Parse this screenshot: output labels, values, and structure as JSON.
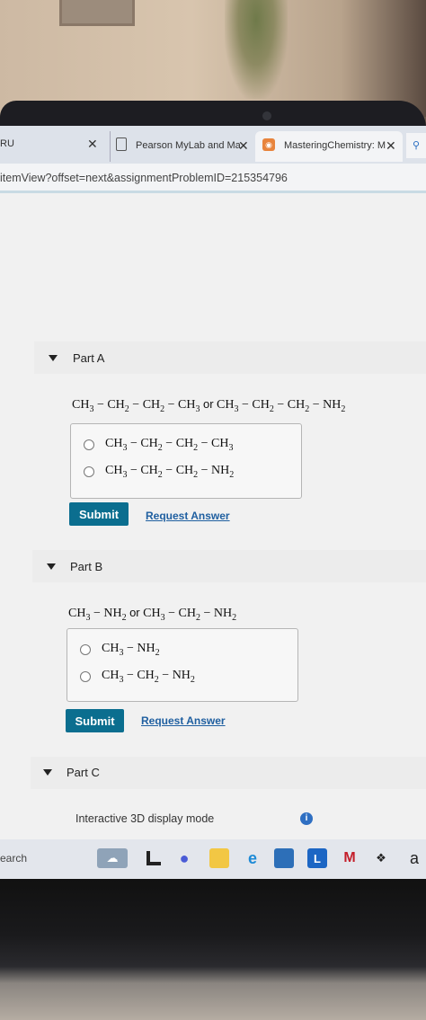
{
  "browser": {
    "tabs": [
      {
        "label": "RU",
        "close": "✕"
      },
      {
        "label": "Pearson MyLab and Ma",
        "close": "✕"
      },
      {
        "label": "MasteringChemistry: M",
        "close": "✕"
      }
    ],
    "url": "itemView?offset=next&assignmentProblemID=215354796"
  },
  "parts": [
    {
      "title": "Part A",
      "question": {
        "left": "CH3 − CH2 − CH2 − CH3",
        "or": "or",
        "right": "CH3 − CH2 − CH2 − NH2"
      },
      "choices": [
        "CH3 − CH2 − CH2 − CH3",
        "CH3 − CH2 − CH2 − NH2"
      ],
      "submit": "Submit",
      "request": "Request Answer"
    },
    {
      "title": "Part B",
      "question": {
        "left": "CH3 − NH2",
        "or": "or",
        "right": "CH3 − CH2 − NH2"
      },
      "choices": [
        "CH3 − NH2",
        "CH3 − CH2 − NH2"
      ],
      "submit": "Submit",
      "request": "Request Answer"
    },
    {
      "title": "Part C"
    }
  ],
  "footer": {
    "display_mode": "Interactive 3D display mode",
    "info_icon": "info-icon"
  },
  "taskbar": {
    "search": "earch",
    "icons": [
      "weather-icon",
      "file-explorer-icon",
      "chat-icon",
      "folder-icon",
      "edge-icon",
      "store-icon",
      "l-app-icon",
      "mcafee-icon",
      "dropbox-icon",
      "amazon-icon"
    ],
    "amazon_label": "a"
  }
}
